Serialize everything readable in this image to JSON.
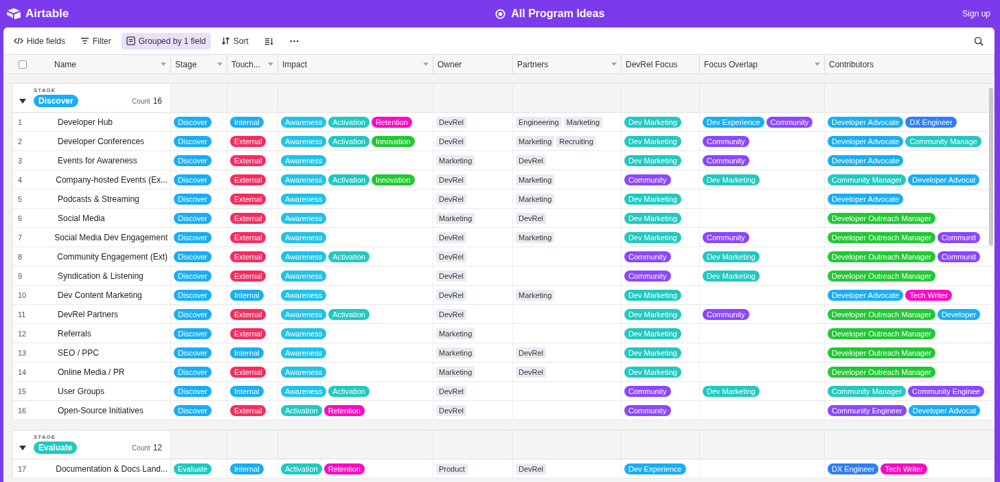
{
  "app": {
    "name": "Airtable",
    "title": "All Program Ideas",
    "sign_up": "Sign up"
  },
  "toolbar": [
    {
      "kind": "hide",
      "label": "Hide fields",
      "selected": false
    },
    {
      "kind": "filter",
      "label": "Filter",
      "selected": false
    },
    {
      "kind": "group",
      "label": "Grouped by 1 field",
      "selected": true
    },
    {
      "kind": "sort",
      "label": "Sort",
      "selected": false
    },
    {
      "kind": "height",
      "selected": false
    },
    {
      "kind": "more",
      "selected": false
    }
  ],
  "select_all": {
    "checked": false
  },
  "columns": [
    {
      "label": "Name",
      "menu": true
    },
    {
      "label": "Stage",
      "menu": true
    },
    {
      "label": "Touch...",
      "menu": true
    },
    {
      "label": "Impact",
      "menu": true
    },
    {
      "label": "Owner",
      "menu": false
    },
    {
      "label": "Partners",
      "menu": true
    },
    {
      "label": "DevRel Focus",
      "menu": false
    },
    {
      "label": "Focus Overlap",
      "menu": true
    },
    {
      "label": "Contributors",
      "menu": false
    }
  ],
  "groups": [
    {
      "field": "STAGE",
      "value": {
        "label": "Discover",
        "color": "#18aef5"
      },
      "count_label": "Count",
      "count": "16",
      "expanded": true,
      "rows": [
        {
          "num": "1",
          "name": "Developer Hub",
          "stage": [
            {
              "label": "Discover",
              "color": "#18aef5"
            }
          ],
          "touch": [
            {
              "label": "Internal",
              "color": "#18aef5"
            }
          ],
          "impact": [
            {
              "label": "Awareness",
              "color": "#1fc2e8"
            },
            {
              "label": "Activation",
              "color": "#20c9c0"
            },
            {
              "label": "Retention",
              "color": "#ff08c2"
            }
          ],
          "owner": [
            "DevRel"
          ],
          "partners": [
            "Engineering",
            "Marketing"
          ],
          "focus": [
            {
              "label": "Dev Marketing",
              "color": "#20c9c0"
            }
          ],
          "overlap": [
            {
              "label": "Dev Experience",
              "color": "#18aef5"
            },
            {
              "label": "Community",
              "color": "#8b46ff"
            }
          ],
          "contributors": [
            {
              "label": "Developer Advocate",
              "color": "#18aef5"
            },
            {
              "label": "DX Engineer",
              "color": "#2d7ff9"
            }
          ]
        },
        {
          "num": "2",
          "name": "Developer Conferences",
          "stage": [
            {
              "label": "Discover",
              "color": "#18aef5"
            }
          ],
          "touch": [
            {
              "label": "External",
              "color": "#f82b60"
            }
          ],
          "impact": [
            {
              "label": "Awareness",
              "color": "#1fc2e8"
            },
            {
              "label": "Activation",
              "color": "#20c9c0"
            },
            {
              "label": "Innovation",
              "color": "#20c933"
            }
          ],
          "owner": [
            "DevRel"
          ],
          "partners": [
            "Marketing",
            "Recruiting"
          ],
          "focus": [
            {
              "label": "Dev Marketing",
              "color": "#20c9c0"
            }
          ],
          "overlap": [
            {
              "label": "Community",
              "color": "#8b46ff"
            }
          ],
          "contributors": [
            {
              "label": "Developer Advocate",
              "color": "#18aef5"
            },
            {
              "label": "Community Manage",
              "color": "#20c9c0"
            }
          ]
        },
        {
          "num": "3",
          "name": "Events for Awareness",
          "stage": [
            {
              "label": "Discover",
              "color": "#18aef5"
            }
          ],
          "touch": [
            {
              "label": "External",
              "color": "#f82b60"
            }
          ],
          "impact": [
            {
              "label": "Awareness",
              "color": "#1fc2e8"
            }
          ],
          "owner": [
            "Marketing"
          ],
          "partners": [
            "DevRel"
          ],
          "focus": [
            {
              "label": "Dev Marketing",
              "color": "#20c9c0"
            }
          ],
          "overlap": [
            {
              "label": "Community",
              "color": "#8b46ff"
            }
          ],
          "contributors": [
            {
              "label": "Developer Advocate",
              "color": "#18aef5"
            }
          ]
        },
        {
          "num": "4",
          "name": "Company-hosted Events (Ex...",
          "stage": [
            {
              "label": "Discover",
              "color": "#18aef5"
            }
          ],
          "touch": [
            {
              "label": "External",
              "color": "#f82b60"
            }
          ],
          "impact": [
            {
              "label": "Awareness",
              "color": "#1fc2e8"
            },
            {
              "label": "Activation",
              "color": "#20c9c0"
            },
            {
              "label": "Innovation",
              "color": "#20c933"
            }
          ],
          "owner": [
            "DevRel"
          ],
          "partners": [
            "Marketing"
          ],
          "focus": [
            {
              "label": "Community",
              "color": "#8b46ff"
            }
          ],
          "overlap": [
            {
              "label": "Dev Marketing",
              "color": "#20c9c0"
            }
          ],
          "contributors": [
            {
              "label": "Community Manager",
              "color": "#20c9c0"
            },
            {
              "label": "Developer Advocat",
              "color": "#18aef5"
            }
          ]
        },
        {
          "num": "5",
          "name": "Podcasts & Streaming",
          "stage": [
            {
              "label": "Discover",
              "color": "#18aef5"
            }
          ],
          "touch": [
            {
              "label": "External",
              "color": "#f82b60"
            }
          ],
          "impact": [
            {
              "label": "Awareness",
              "color": "#1fc2e8"
            }
          ],
          "owner": [
            "DevRel"
          ],
          "partners": [
            "Marketing"
          ],
          "focus": [
            {
              "label": "Dev Marketing",
              "color": "#20c9c0"
            }
          ],
          "overlap": [],
          "contributors": [
            {
              "label": "Developer Advocate",
              "color": "#18aef5"
            }
          ]
        },
        {
          "num": "6",
          "name": "Social Media",
          "stage": [
            {
              "label": "Discover",
              "color": "#18aef5"
            }
          ],
          "touch": [
            {
              "label": "External",
              "color": "#f82b60"
            }
          ],
          "impact": [
            {
              "label": "Awareness",
              "color": "#1fc2e8"
            }
          ],
          "owner": [
            "Marketing"
          ],
          "partners": [
            "DevRel"
          ],
          "focus": [
            {
              "label": "Dev Marketing",
              "color": "#20c9c0"
            }
          ],
          "overlap": [],
          "contributors": [
            {
              "label": "Developer Outreach Manager",
              "color": "#20c933"
            }
          ]
        },
        {
          "num": "7",
          "name": "Social Media Dev Engagement",
          "stage": [
            {
              "label": "Discover",
              "color": "#18aef5"
            }
          ],
          "touch": [
            {
              "label": "External",
              "color": "#f82b60"
            }
          ],
          "impact": [
            {
              "label": "Awareness",
              "color": "#1fc2e8"
            }
          ],
          "owner": [
            "DevRel"
          ],
          "partners": [
            "Marketing"
          ],
          "focus": [
            {
              "label": "Dev Marketing",
              "color": "#20c9c0"
            }
          ],
          "overlap": [
            {
              "label": "Community",
              "color": "#8b46ff"
            }
          ],
          "contributors": [
            {
              "label": "Developer Outreach Manager",
              "color": "#20c933"
            },
            {
              "label": "Communit",
              "color": "#8b46ff"
            }
          ]
        },
        {
          "num": "8",
          "name": "Community Engagement (Ext)",
          "stage": [
            {
              "label": "Discover",
              "color": "#18aef5"
            }
          ],
          "touch": [
            {
              "label": "External",
              "color": "#f82b60"
            }
          ],
          "impact": [
            {
              "label": "Awareness",
              "color": "#1fc2e8"
            },
            {
              "label": "Activation",
              "color": "#20c9c0"
            }
          ],
          "owner": [
            "DevRel"
          ],
          "partners": [],
          "focus": [
            {
              "label": "Community",
              "color": "#8b46ff"
            }
          ],
          "overlap": [
            {
              "label": "Dev Marketing",
              "color": "#20c9c0"
            }
          ],
          "contributors": [
            {
              "label": "Developer Outreach Manager",
              "color": "#20c933"
            },
            {
              "label": "Communit",
              "color": "#8b46ff"
            }
          ]
        },
        {
          "num": "9",
          "name": "Syndication & Listening",
          "stage": [
            {
              "label": "Discover",
              "color": "#18aef5"
            }
          ],
          "touch": [
            {
              "label": "External",
              "color": "#f82b60"
            }
          ],
          "impact": [
            {
              "label": "Awareness",
              "color": "#1fc2e8"
            }
          ],
          "owner": [
            "DevRel"
          ],
          "partners": [],
          "focus": [
            {
              "label": "Community",
              "color": "#8b46ff"
            }
          ],
          "overlap": [
            {
              "label": "Dev Marketing",
              "color": "#20c9c0"
            }
          ],
          "contributors": [
            {
              "label": "Developer Outreach Manager",
              "color": "#20c933"
            }
          ]
        },
        {
          "num": "10",
          "name": "Dev Content Marketing",
          "stage": [
            {
              "label": "Discover",
              "color": "#18aef5"
            }
          ],
          "touch": [
            {
              "label": "Internal",
              "color": "#18aef5"
            }
          ],
          "impact": [
            {
              "label": "Awareness",
              "color": "#1fc2e8"
            }
          ],
          "owner": [
            "DevRel"
          ],
          "partners": [
            "Marketing"
          ],
          "focus": [
            {
              "label": "Dev Marketing",
              "color": "#20c9c0"
            }
          ],
          "overlap": [],
          "contributors": [
            {
              "label": "Developer Advocate",
              "color": "#18aef5"
            },
            {
              "label": "Tech Writer",
              "color": "#ff08c2"
            }
          ]
        },
        {
          "num": "11",
          "name": "DevRel Partners",
          "stage": [
            {
              "label": "Discover",
              "color": "#18aef5"
            }
          ],
          "touch": [
            {
              "label": "External",
              "color": "#f82b60"
            }
          ],
          "impact": [
            {
              "label": "Awareness",
              "color": "#1fc2e8"
            },
            {
              "label": "Activation",
              "color": "#20c9c0"
            }
          ],
          "owner": [
            "DevRel"
          ],
          "partners": [],
          "focus": [
            {
              "label": "Dev Marketing",
              "color": "#20c9c0"
            }
          ],
          "overlap": [
            {
              "label": "Community",
              "color": "#8b46ff"
            }
          ],
          "contributors": [
            {
              "label": "Developer Outreach Manager",
              "color": "#20c933"
            },
            {
              "label": "Developer",
              "color": "#18aef5"
            }
          ]
        },
        {
          "num": "12",
          "name": "Referrals",
          "stage": [
            {
              "label": "Discover",
              "color": "#18aef5"
            }
          ],
          "touch": [
            {
              "label": "External",
              "color": "#f82b60"
            }
          ],
          "impact": [
            {
              "label": "Awareness",
              "color": "#1fc2e8"
            }
          ],
          "owner": [
            "Marketing"
          ],
          "partners": [],
          "focus": [
            {
              "label": "Dev Marketing",
              "color": "#20c9c0"
            }
          ],
          "overlap": [],
          "contributors": [
            {
              "label": "Developer Outreach Manager",
              "color": "#20c933"
            }
          ]
        },
        {
          "num": "13",
          "name": "SEO / PPC",
          "stage": [
            {
              "label": "Discover",
              "color": "#18aef5"
            }
          ],
          "touch": [
            {
              "label": "Internal",
              "color": "#18aef5"
            }
          ],
          "impact": [
            {
              "label": "Awareness",
              "color": "#1fc2e8"
            }
          ],
          "owner": [
            "Marketing"
          ],
          "partners": [
            "DevRel"
          ],
          "focus": [
            {
              "label": "Dev Marketing",
              "color": "#20c9c0"
            }
          ],
          "overlap": [],
          "contributors": [
            {
              "label": "Developer Outreach Manager",
              "color": "#20c933"
            }
          ]
        },
        {
          "num": "14",
          "name": "Online Media / PR",
          "stage": [
            {
              "label": "Discover",
              "color": "#18aef5"
            }
          ],
          "touch": [
            {
              "label": "External",
              "color": "#f82b60"
            }
          ],
          "impact": [
            {
              "label": "Awareness",
              "color": "#1fc2e8"
            }
          ],
          "owner": [
            "Marketing"
          ],
          "partners": [
            "DevRel"
          ],
          "focus": [
            {
              "label": "Dev Marketing",
              "color": "#20c9c0"
            }
          ],
          "overlap": [],
          "contributors": [
            {
              "label": "Developer Outreach Manager",
              "color": "#20c933"
            }
          ]
        },
        {
          "num": "15",
          "name": "User Groups",
          "stage": [
            {
              "label": "Discover",
              "color": "#18aef5"
            }
          ],
          "touch": [
            {
              "label": "Internal",
              "color": "#18aef5"
            }
          ],
          "impact": [
            {
              "label": "Awareness",
              "color": "#1fc2e8"
            },
            {
              "label": "Activation",
              "color": "#20c9c0"
            }
          ],
          "owner": [
            "DevRel"
          ],
          "partners": [],
          "focus": [
            {
              "label": "Community",
              "color": "#8b46ff"
            }
          ],
          "overlap": [
            {
              "label": "Dev Marketing",
              "color": "#20c9c0"
            }
          ],
          "contributors": [
            {
              "label": "Community Manager",
              "color": "#20c9c0"
            },
            {
              "label": "Community Enginee",
              "color": "#8b46ff"
            }
          ]
        },
        {
          "num": "16",
          "name": "Open-Source Initiatives",
          "stage": [
            {
              "label": "Discover",
              "color": "#18aef5"
            }
          ],
          "touch": [
            {
              "label": "External",
              "color": "#f82b60"
            }
          ],
          "impact": [
            {
              "label": "Activation",
              "color": "#20c9c0"
            },
            {
              "label": "Retention",
              "color": "#ff08c2"
            }
          ],
          "owner": [
            "DevRel"
          ],
          "partners": [],
          "focus": [
            {
              "label": "Community",
              "color": "#8b46ff"
            }
          ],
          "overlap": [],
          "contributors": [
            {
              "label": "Community Engineer",
              "color": "#8b46ff"
            },
            {
              "label": "Developer Advocat",
              "color": "#18aef5"
            }
          ]
        }
      ]
    },
    {
      "field": "STAGE",
      "value": {
        "label": "Evaluate",
        "color": "#20c9c0"
      },
      "count_label": "Count",
      "count": "12",
      "expanded": true,
      "rows": [
        {
          "num": "17",
          "name": "Documentation & Docs Land...",
          "stage": [
            {
              "label": "Evaluate",
              "color": "#20c9c0"
            }
          ],
          "touch": [
            {
              "label": "Internal",
              "color": "#18aef5"
            }
          ],
          "impact": [
            {
              "label": "Activation",
              "color": "#20c9c0"
            },
            {
              "label": "Retention",
              "color": "#ff08c2"
            }
          ],
          "owner": [
            "Product"
          ],
          "partners": [
            "DevRel"
          ],
          "focus": [
            {
              "label": "Dev Experience",
              "color": "#18aef5"
            }
          ],
          "overlap": [],
          "contributors": [
            {
              "label": "DX Engineer",
              "color": "#2d7ff9"
            },
            {
              "label": "Tech Writer",
              "color": "#ff08c2"
            }
          ]
        }
      ]
    }
  ]
}
